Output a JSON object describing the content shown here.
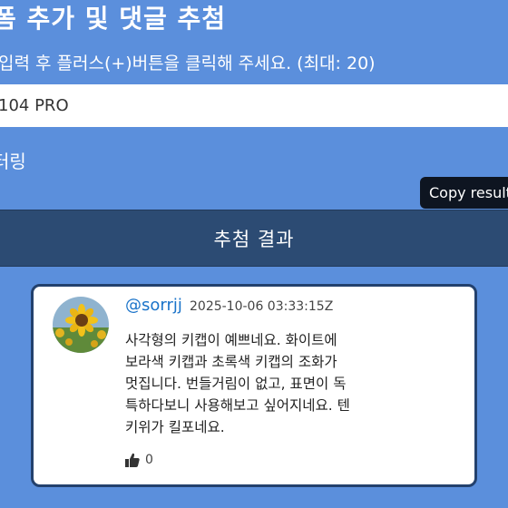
{
  "header": {
    "title": "폼 추가 및 댓글 추첨",
    "instruction": "입력 후 플러스(+)버튼을 클릭해 주세요. (최대: 20)"
  },
  "product_input": {
    "value": "104 PRO"
  },
  "sub_label": "터링",
  "tooltip": {
    "text": "Copy result"
  },
  "result_bar": {
    "label": "추첨 결과"
  },
  "comment": {
    "author": "@sorrjj",
    "timestamp": "2025-10-06 03:33:15Z",
    "text": "사각형의 키캡이 예쁘네요. 화이트에\n보라색 키캡과 초록색 키캡의 조화가\n멋집니다. 번들거림이 없고, 표면이 독\n특하다보니 사용해보고 싶어지네요. 텐\n키위가 킬포네요.",
    "likes": "0",
    "like_icon": "thumbs-up-icon",
    "avatar_icon": "sunflower-avatar"
  },
  "colors": {
    "background": "#5b8fdc",
    "result_bar": "#2c4b73",
    "card_border": "#23416d",
    "author_link": "#1a73c9",
    "tooltip": "#0e1521"
  }
}
